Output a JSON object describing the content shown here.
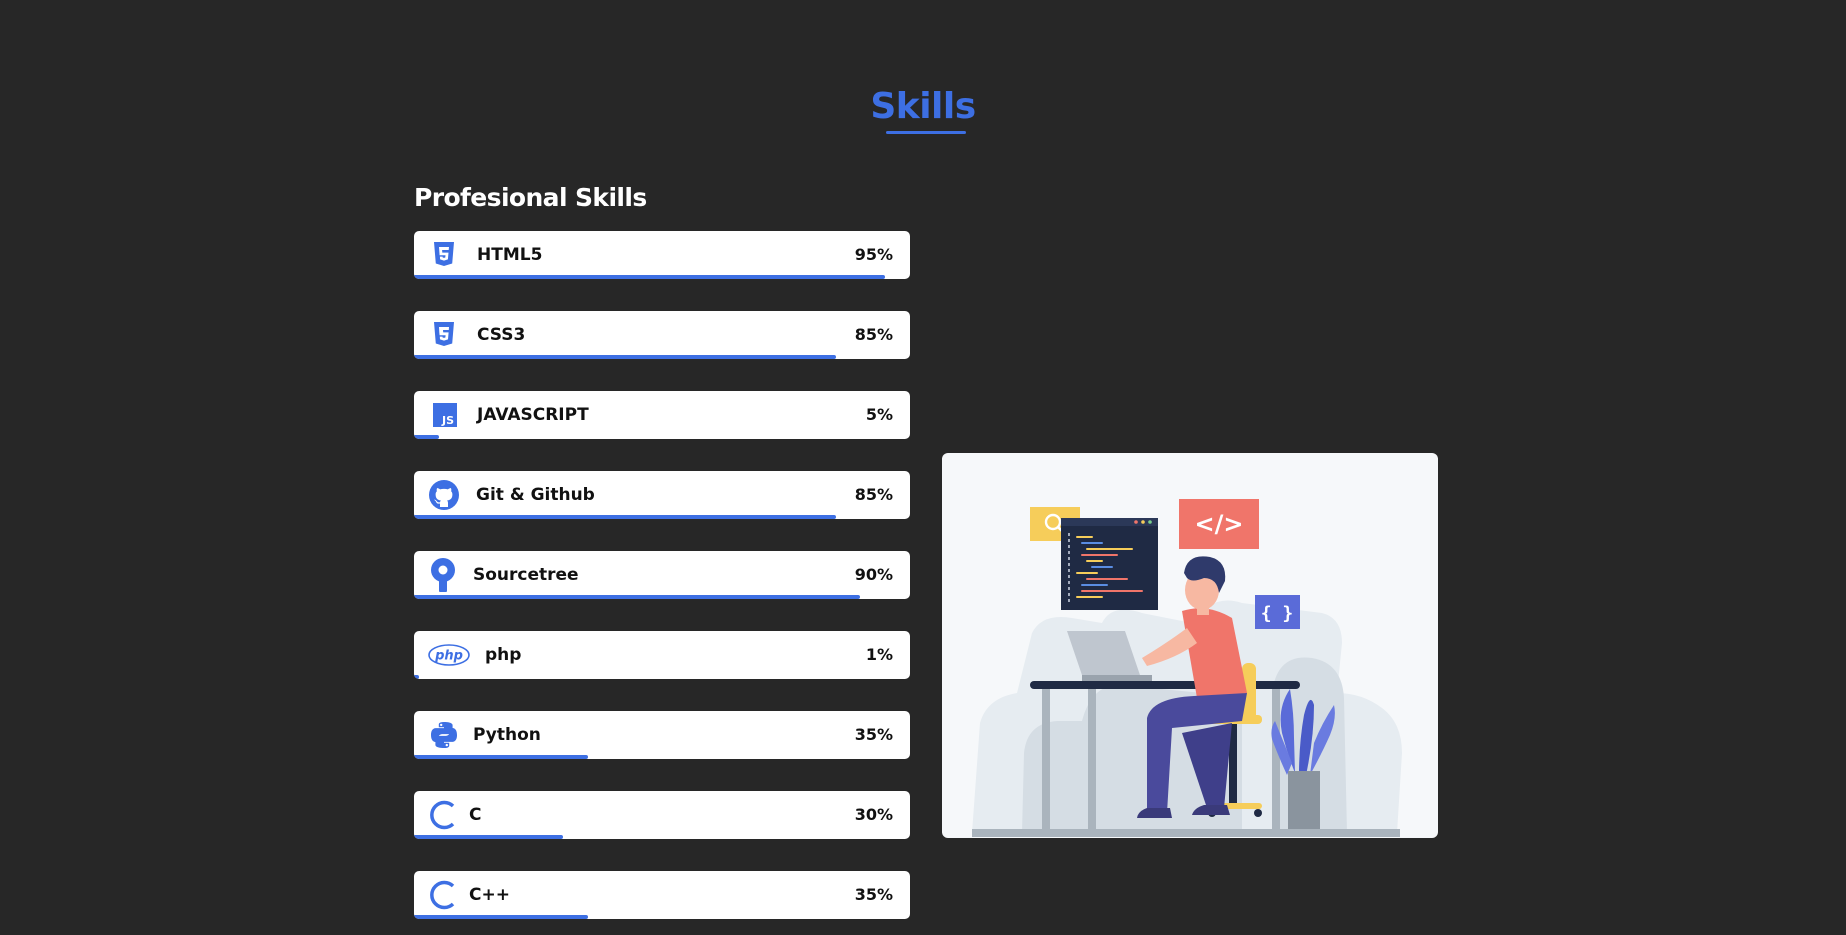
{
  "section": {
    "title": "Skills"
  },
  "professional": {
    "title": "Profesional Skills"
  },
  "skills": [
    {
      "name": "HTML5",
      "percent": "95%",
      "level": 95,
      "icon": "html5-icon"
    },
    {
      "name": "CSS3",
      "percent": "85%",
      "level": 85,
      "icon": "css3-icon"
    },
    {
      "name": "JAVASCRIPT",
      "percent": "5%",
      "level": 5,
      "icon": "javascript-icon"
    },
    {
      "name": "Git & Github",
      "percent": "85%",
      "level": 85,
      "icon": "github-icon"
    },
    {
      "name": "Sourcetree",
      "percent": "90%",
      "level": 90,
      "icon": "sourcetree-icon"
    },
    {
      "name": "php",
      "percent": "1%",
      "level": 1,
      "icon": "php-icon"
    },
    {
      "name": "Python",
      "percent": "35%",
      "level": 35,
      "icon": "python-icon"
    },
    {
      "name": "C",
      "percent": "30%",
      "level": 30,
      "icon": "c-icon"
    },
    {
      "name": "C++",
      "percent": "35%",
      "level": 35,
      "icon": "cplusplus-icon"
    }
  ],
  "illustration": {
    "icon": "developer-at-desk-illustration",
    "code_tag": "</>",
    "braces_tag": "{ }"
  },
  "colors": {
    "background": "#272727",
    "accent": "#3d6fe3",
    "card": "#ffffff",
    "text_dark": "#111111",
    "text_light": "#ffffff"
  }
}
